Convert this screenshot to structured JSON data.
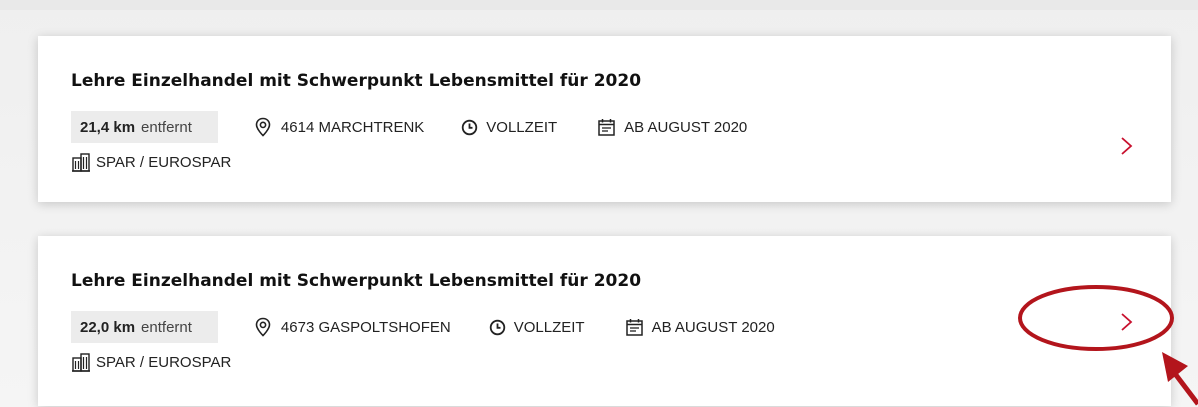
{
  "jobs": [
    {
      "title": "Lehre Einzelhandel mit Schwerpunkt Lebensmittel für 2020",
      "distance_value": "21,4 km",
      "distance_suffix": "entfernt",
      "location": "4614 MARCHTRENK",
      "employment": "VOLLZEIT",
      "start": "AB AUGUST 2020",
      "company": "SPAR / EUROSPAR"
    },
    {
      "title": "Lehre Einzelhandel mit Schwerpunkt Lebensmittel für 2020",
      "distance_value": "22,0 km",
      "distance_suffix": "entfernt",
      "location": "4673 GASPOLTSHOFEN",
      "employment": "VOLLZEIT",
      "start": "AB AUGUST 2020",
      "company": "SPAR / EUROSPAR"
    }
  ],
  "icons": {
    "location": "map-pin-icon",
    "employment": "clock-icon",
    "start": "calendar-icon",
    "company": "building-icon",
    "open": "chevron-right-icon"
  },
  "colors": {
    "accent": "#c8102e",
    "annotation": "#b3151c",
    "card_bg": "#ffffff",
    "distance_bg": "#ececec"
  }
}
